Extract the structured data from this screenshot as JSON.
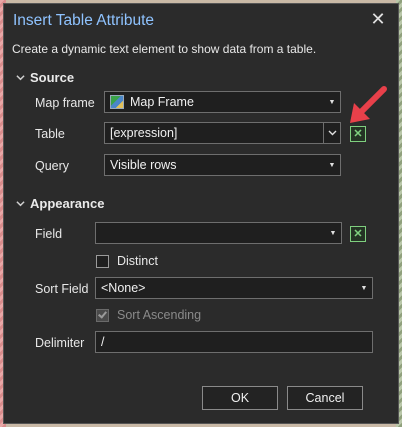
{
  "dialog": {
    "title": "Insert Table Attribute",
    "description": "Create a dynamic text element to show data from a table."
  },
  "source": {
    "heading": "Source",
    "map_frame_label": "Map frame",
    "map_frame_value": "Map Frame",
    "table_label": "Table",
    "table_value": "[expression]",
    "query_label": "Query",
    "query_value": "Visible rows"
  },
  "appearance": {
    "heading": "Appearance",
    "field_label": "Field",
    "field_value": "",
    "distinct_label": "Distinct",
    "distinct_checked": false,
    "sort_field_label": "Sort Field",
    "sort_field_value": "<None>",
    "sort_ascending_label": "Sort Ascending",
    "sort_ascending_checked": true,
    "delimiter_label": "Delimiter",
    "delimiter_value": "/"
  },
  "buttons": {
    "ok": "OK",
    "cancel": "Cancel"
  },
  "colors": {
    "title": "#8fc3ff",
    "arrow": "#e8404a",
    "expression_button": "#7fd07f"
  }
}
